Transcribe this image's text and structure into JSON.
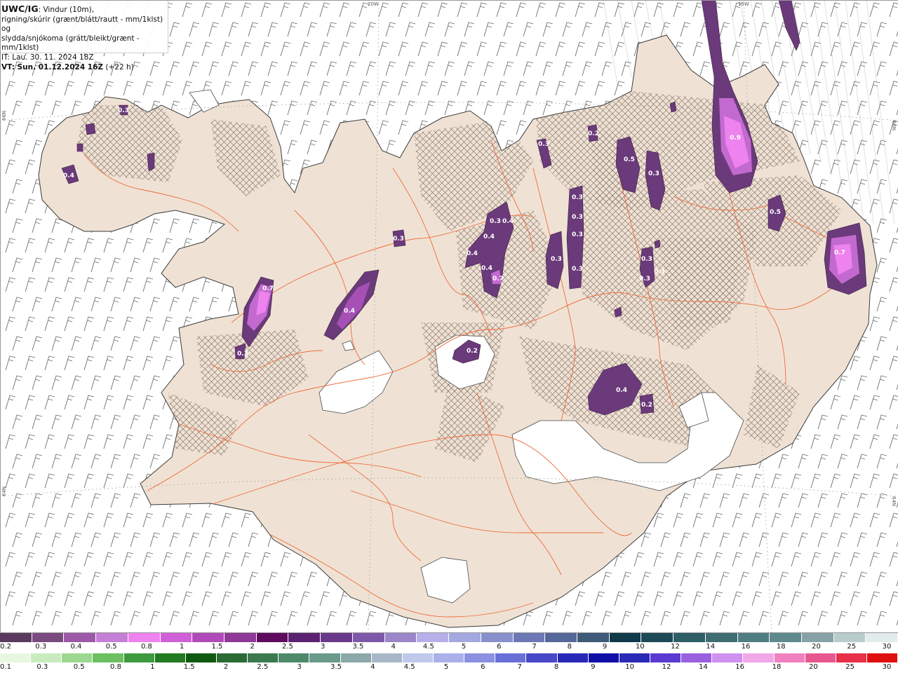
{
  "header": {
    "model": "UWC/IG",
    "line1_rest": ": Vindur (10m),",
    "line2": "rigning/skúrir (grænt/blátt/rautt - mm/1klst) og",
    "line3": "slydda/snjókoma (grátt/bleikt/grænt - mm/1klst)",
    "init_time": "IT: Lau. 30. 11. 2024 18Z",
    "valid_label": "VT: Sun. 01.12.2024 16Z",
    "valid_rest": " (+22 h)"
  },
  "grid_labels": {
    "lon_20w": "20W",
    "lon_15w": "15W",
    "lat_66n_left": "66N",
    "lat_66n_right": "66N",
    "lat_64n_left": "64N",
    "lat_64n_right": "64N"
  },
  "precip_labels": [
    "0.4",
    "0.7",
    "0.3",
    "0.4",
    "0.3",
    "0.4",
    "0.3",
    "0.4",
    "0.4",
    "0.4",
    "0.7",
    "0.3",
    "0.3",
    "0.3",
    "0.3",
    "0.3",
    "0.3",
    "0.2",
    "0.5",
    "0.3",
    "0.3",
    "0.3",
    "0.9",
    "0.5",
    "0.7",
    "0.2",
    "0.4",
    "0.2",
    "0.3",
    "0.3"
  ],
  "scale_snow": {
    "colors": [
      "#5a3a5e",
      "#7a4a80",
      "#9b59a8",
      "#c67fd6",
      "#ee82ee",
      "#d060d8",
      "#b04ab8",
      "#8e3a96",
      "#5e0a5e",
      "#5a2270",
      "#6a3a8a",
      "#7e58a8",
      "#9a86c8",
      "#b6b0ea",
      "#a4a8e0",
      "#8890cc",
      "#6c78b4",
      "#56689a",
      "#3e5a78",
      "#103a4a",
      "#1e4a58",
      "#2e5e66",
      "#3e6e72",
      "#4e7e82",
      "#5e8a8e",
      "#86a2a6",
      "#b8cccc",
      "#e2ecec"
    ],
    "labels": [
      "0.2",
      "0.3",
      "0.4",
      "0.5",
      "0.8",
      "1",
      "1.5",
      "2",
      "2.5",
      "3",
      "3.5",
      "4",
      "4.5",
      "5",
      "6",
      "7",
      "8",
      "9",
      "10",
      "12",
      "14",
      "16",
      "18",
      "20",
      "25",
      "30"
    ]
  },
  "scale_rain": {
    "colors": [
      "#e8f8e0",
      "#c8ecc0",
      "#9cd890",
      "#6cc060",
      "#3e9a3e",
      "#227a22",
      "#0e5a10",
      "#2c6a34",
      "#3c7a4e",
      "#4e8a6a",
      "#6a9a8a",
      "#8ca8a8",
      "#a8b8c8",
      "#c0c8ec",
      "#aab0ea",
      "#8c90e0",
      "#6870d8",
      "#4848c8",
      "#2828b8",
      "#1010a8",
      "#2a2ab8",
      "#5a3ad0",
      "#9a60e0",
      "#d090f0",
      "#f0a8e8",
      "#f080c0",
      "#e85890",
      "#e83048",
      "#e01010"
    ],
    "labels": [
      "0.1",
      "0.3",
      "0.5",
      "0.8",
      "1",
      "1.5",
      "2",
      "2.5",
      "3",
      "3.5",
      "4",
      "4.5",
      "5",
      "6",
      "7",
      "8",
      "9",
      "10",
      "12",
      "14",
      "16",
      "18",
      "20",
      "25",
      "30"
    ]
  },
  "colors": {
    "land": "#efe2d4",
    "road": "#ef6a3a",
    "sea": "#ffffff",
    "precip_dark": "#6b3a7a",
    "precip_mid": "#a650b6",
    "precip_light": "#e98aee"
  }
}
